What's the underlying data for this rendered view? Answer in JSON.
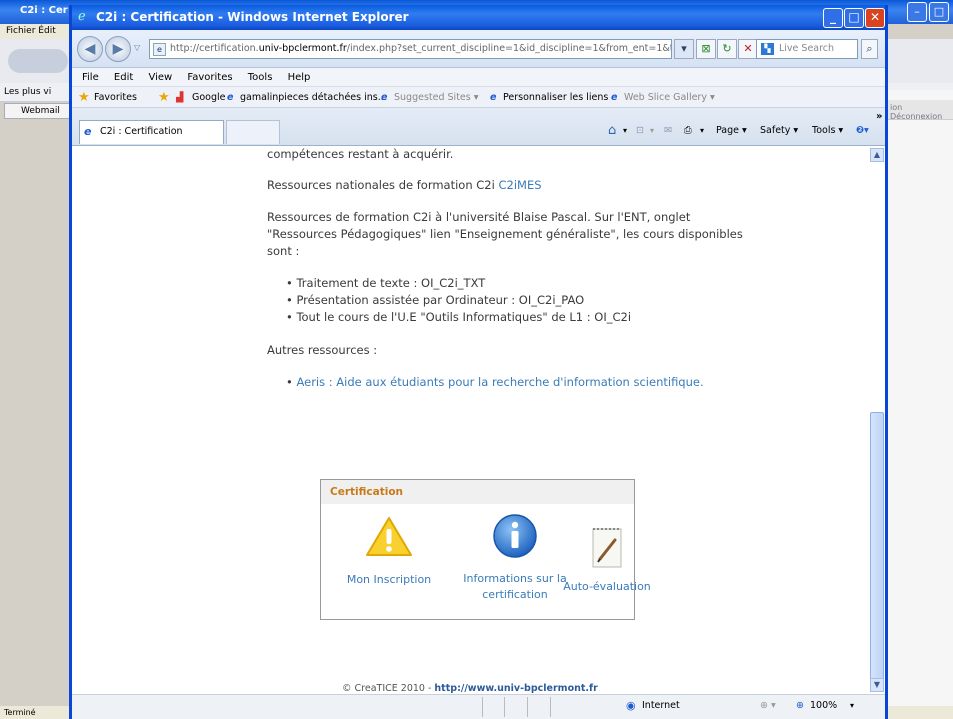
{
  "bg_window": {
    "title": "C2i : Cer",
    "menu": [
      "Fichier",
      "Édit"
    ],
    "bookmark": "Les plus vi",
    "tab": "Webmail",
    "right_panel_text": "Déconnexion",
    "right_panel_prefix": "ion",
    "status": "Terminé"
  },
  "ie": {
    "title": "C2i : Certification - Windows Internet Explorer",
    "address": {
      "prefix": "http://certification.",
      "domain": "univ-bpclermont.fr",
      "suffix": "/index.php?set_current_discipline=1&id_discipline=1&from_ent=1&ticket"
    },
    "search_placeholder": "Live Search",
    "menubar": [
      "File",
      "Edit",
      "View",
      "Favorites",
      "Tools",
      "Help"
    ],
    "favorites": {
      "label": "Favorites",
      "items": [
        "Google",
        "gamalinpieces détachées ins...",
        "Suggested Sites ▾",
        "Personnaliser les liens",
        "Web Slice Gallery ▾"
      ]
    },
    "tab_label": "C2i : Certification",
    "commands": [
      "Page ▾",
      "Safety ▾",
      "Tools ▾"
    ],
    "status": {
      "zone": "Internet",
      "zoom": "100%"
    }
  },
  "content": {
    "top_cut": "compétences restant à acquérir.",
    "ressources_nat_label": "Ressources nationales de formation  C2i",
    "ressources_nat_link": "C2iMES",
    "ubp_lines": [
      "Ressources de formation C2i à l'université Blaise Pascal. Sur l'ENT, onglet",
      "\"Ressources Pédagogiques\" lien \"Enseignement généraliste\", les cours disponibles",
      "sont :"
    ],
    "courses": [
      "Traitement de texte : OI_C2i_TXT",
      "Présentation assistée par Ordinateur : OI_C2i_PAO",
      "Tout le cours de l'U.E \"Outils Informatiques\" de L1 : OI_C2i"
    ],
    "autres_label": "Autres ressources :",
    "autres_link": "Aeris : Aide aux étudiants pour la recherche d'information scientifique.",
    "cert_box": {
      "title": "Certification",
      "items": [
        {
          "label": "Mon Inscription",
          "icon": "warning-icon"
        },
        {
          "label_l1": "Informations sur la",
          "label_l2": "certification",
          "icon": "info-icon"
        },
        {
          "label": "Auto-évaluation",
          "icon": "notepad-icon"
        }
      ]
    },
    "footer": {
      "text": "© CreaTICE 2010 - ",
      "url": "http://www.univ-bpclermont.fr"
    }
  }
}
